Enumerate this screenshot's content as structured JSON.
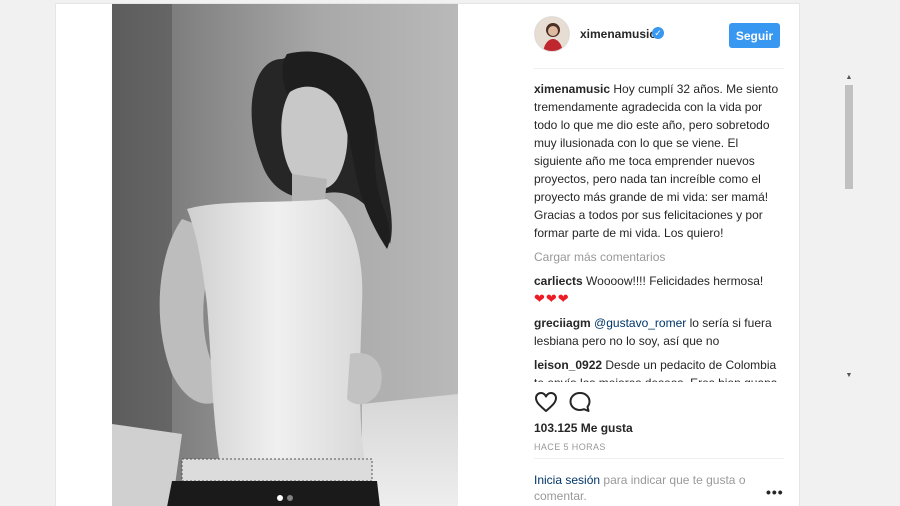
{
  "post": {
    "author": "ximenamusic",
    "follow_label": "Seguir",
    "caption_user": "ximenamusic",
    "caption": "Hoy cumplí 32 años. Me siento tremendamente agradecida con la vida por todo lo que me dio este año, pero sobretodo muy ilusionada con lo que se viene. El siguiente año me toca emprender nuevos proyectos, pero nada tan increíble como el proyecto más grande de mi vida: ser mamá! Gracias a todos por sus felicitaciones y por formar parte de mi vida. Los quiero!",
    "load_more": "Cargar más comentarios",
    "comments": [
      {
        "user": "carliects",
        "text": "Woooow!!!! Felicidades hermosa!",
        "hearts": "❤❤❤"
      },
      {
        "user": "greciiagm",
        "mention": "@gustavo_romer",
        "text": "lo sería si fuera lesbiana pero no lo soy, así que no"
      },
      {
        "user": "leison_0922",
        "text": "Desde un pedacito de Colombia te envío los mejores deseos. Eres bien guapa y magnífica artista."
      }
    ],
    "likes": "103.125 Me gusta",
    "time": "HACE 5 HORAS",
    "login_link": "Inicia sesión",
    "login_text": "para indicar que te gusta o comentar.",
    "more_glyph": "•••"
  },
  "colors": {
    "accent": "#3897f0",
    "link": "#003569",
    "muted": "#999999",
    "heart": "#ed1c24"
  },
  "icons": {
    "like": "heart-outline-icon",
    "comment": "speech-bubble-icon",
    "verified": "verified-badge-icon",
    "more": "ellipsis-icon"
  }
}
